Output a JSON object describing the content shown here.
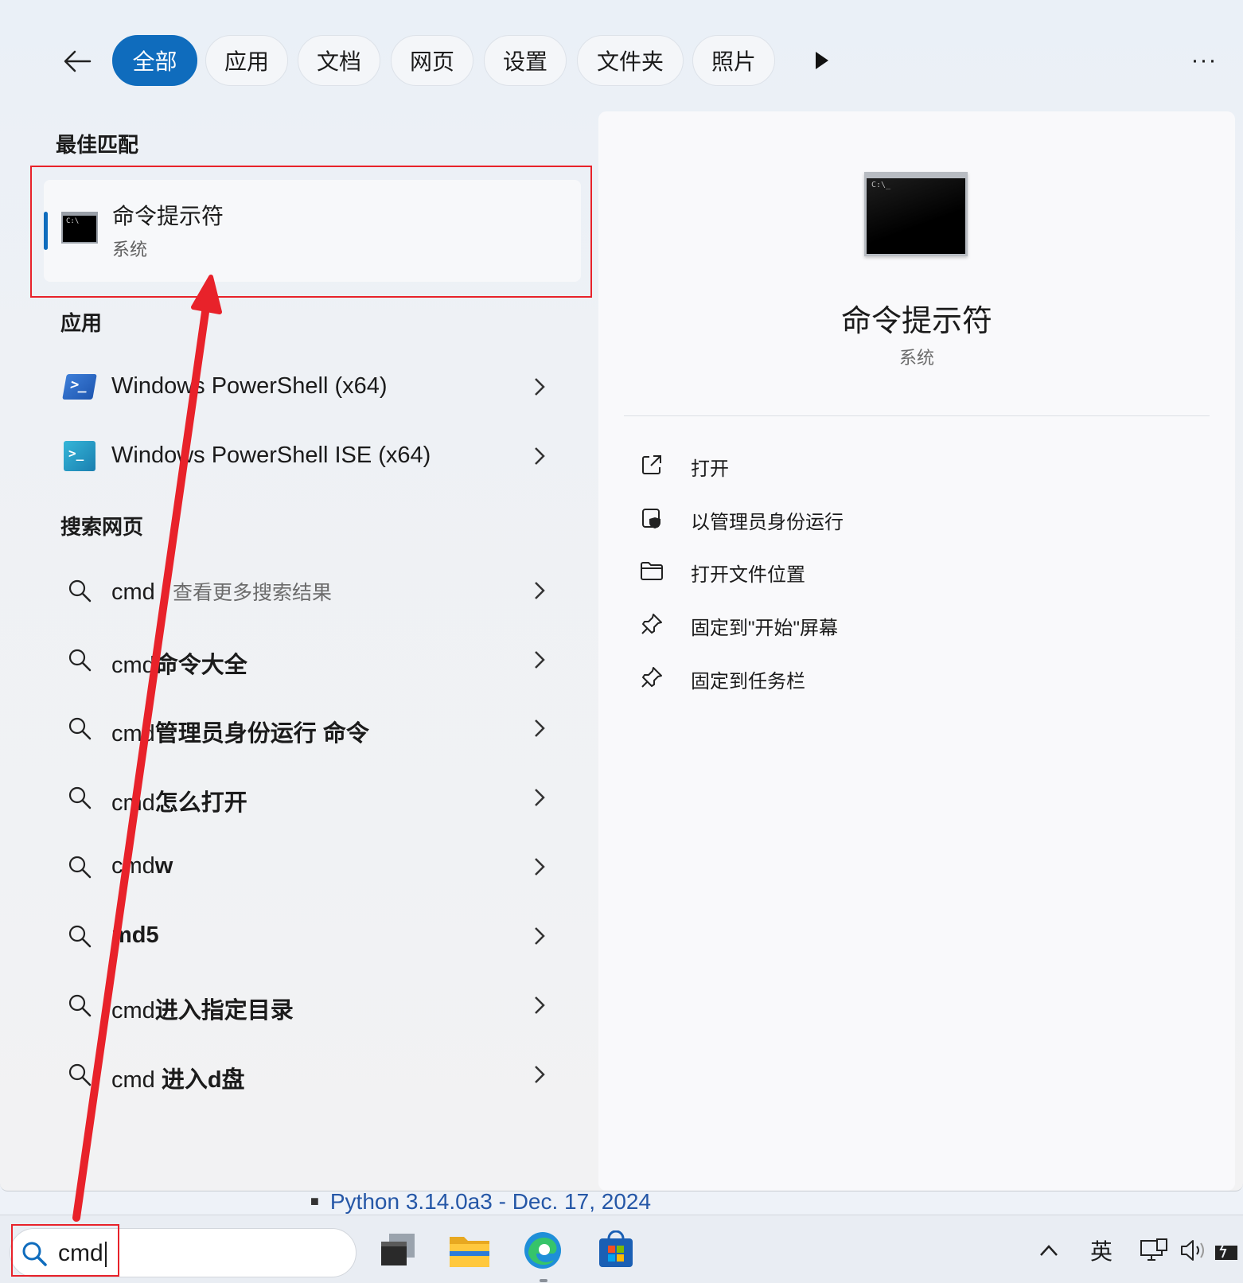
{
  "filters": {
    "items": [
      {
        "label": "全部",
        "active": true
      },
      {
        "label": "应用",
        "active": false
      },
      {
        "label": "文档",
        "active": false
      },
      {
        "label": "网页",
        "active": false
      },
      {
        "label": "设置",
        "active": false
      },
      {
        "label": "文件夹",
        "active": false
      },
      {
        "label": "照片",
        "active": false
      }
    ],
    "more_label": "···"
  },
  "sections": {
    "best_match": "最佳匹配",
    "apps": "应用",
    "web": "搜索网页"
  },
  "best_match": {
    "title": "命令提示符",
    "subtitle": "系统"
  },
  "apps": [
    {
      "label": "Windows PowerShell (x64)"
    },
    {
      "label": "Windows PowerShell ISE (x64)"
    }
  ],
  "web_results": [
    {
      "prefix": "cmd",
      "suffix": " - 查看更多搜索结果",
      "suffix_style": "muted"
    },
    {
      "prefix": "cmd",
      "suffix": "命令大全",
      "suffix_style": "bold"
    },
    {
      "prefix": "cmd",
      "suffix": "管理员身份运行 命令",
      "suffix_style": "bold"
    },
    {
      "prefix": "cmd",
      "suffix": "怎么打开",
      "suffix_style": "bold"
    },
    {
      "prefix": "cmd",
      "suffix": "w",
      "suffix_style": "bold"
    },
    {
      "prefix": "",
      "suffix": "md5",
      "suffix_style": "bold"
    },
    {
      "prefix": "cmd",
      "suffix": "进入指定目录",
      "suffix_style": "bold"
    },
    {
      "prefix": "cmd ",
      "suffix": "进入d盘",
      "suffix_style": "bold"
    }
  ],
  "detail": {
    "title": "命令提示符",
    "subtitle": "系统",
    "actions": [
      {
        "label": "打开",
        "icon": "open-external-icon"
      },
      {
        "label": "以管理员身份运行",
        "icon": "shield-admin-icon"
      },
      {
        "label": "打开文件位置",
        "icon": "folder-icon"
      },
      {
        "label": "固定到\"开始\"屏幕",
        "icon": "pin-icon"
      },
      {
        "label": "固定到任务栏",
        "icon": "pin-icon"
      }
    ]
  },
  "background_page": {
    "link_text": "Python 3.14.0a3 - Dec. 17, 2024"
  },
  "taskbar": {
    "search_value": "cmd",
    "tray_ime": "英"
  },
  "colors": {
    "accent": "#0f6cbd",
    "annotation": "#e8222a"
  }
}
